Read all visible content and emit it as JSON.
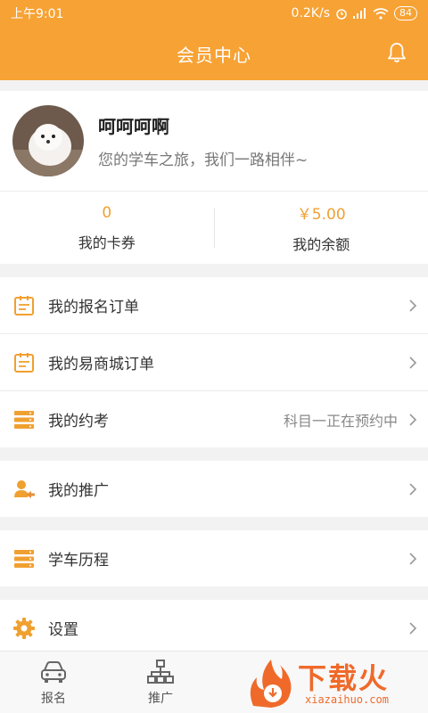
{
  "status_bar": {
    "time": "上午9:01",
    "speed": "0.2K/s",
    "battery": "84"
  },
  "header": {
    "title": "会员中心"
  },
  "profile": {
    "name": "呵呵呵啊",
    "slogan": "您的学车之旅，我们一路相伴~"
  },
  "stats": [
    {
      "value": "0",
      "label": "我的卡券"
    },
    {
      "value": "￥5.00",
      "label": "我的余额"
    }
  ],
  "menu": [
    {
      "label": "我的报名订单",
      "icon": "clipboard-icon",
      "extra": ""
    },
    {
      "label": "我的易商城订单",
      "icon": "clipboard-icon",
      "extra": ""
    },
    {
      "label": "我的约考",
      "icon": "stack-icon",
      "extra": "科目一正在预约中"
    },
    {
      "label": "我的推广",
      "icon": "user-share-icon",
      "extra": ""
    },
    {
      "label": "学车历程",
      "icon": "stack-icon",
      "extra": ""
    },
    {
      "label": "设置",
      "icon": "gear-icon",
      "extra": ""
    }
  ],
  "tabs": [
    {
      "label": "报名",
      "icon": "car-icon"
    },
    {
      "label": "推广",
      "icon": "org-chart-icon"
    }
  ],
  "watermark": {
    "text": "下载火",
    "sub": "xiazaihuo.com"
  },
  "colors": {
    "primary": "#f7a234",
    "accent_text": "#f0a030",
    "background": "#f2f2f2"
  }
}
